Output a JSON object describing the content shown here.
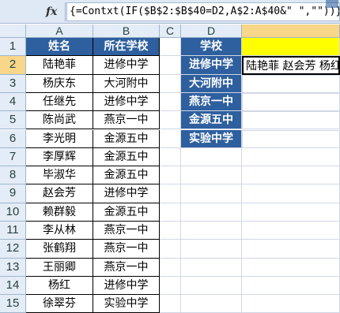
{
  "formula": "{=Contxt(IF($B$2:$B$40=D2,A$2:A$40&\" \",\"\"))}",
  "fx_label": "fx",
  "columns": [
    "A",
    "B",
    "C",
    "D"
  ],
  "rows": [
    "1",
    "2",
    "3",
    "4",
    "5",
    "6",
    "7",
    "8",
    "9",
    "10",
    "11",
    "12",
    "13",
    "14",
    "15"
  ],
  "table_headers": [
    "姓名",
    "所在学校"
  ],
  "names": [
    "陆艳菲",
    "杨庆东",
    "任继先",
    "陈尚武",
    "李光明",
    "李厚辉",
    "毕淑华",
    "赵会芳",
    "赖群毅",
    "李从林",
    "张鹤翔",
    "王丽卿",
    "杨红",
    "徐翠芬"
  ],
  "schools": [
    "进修中学",
    "大河附中",
    "进修中学",
    "燕京一中",
    "金源五中",
    "金源五中",
    "金源五中",
    "进修中学",
    "金源五中",
    "燕京一中",
    "燕京一中",
    "燕京一中",
    "进修中学",
    "实验中学"
  ],
  "lookup_header": "学校",
  "lookup_schools": [
    "进修中学",
    "大河附中",
    "燕京一中",
    "金源五中",
    "实验中学"
  ],
  "result_text": "陆艳菲 赵会芳 杨红"
}
